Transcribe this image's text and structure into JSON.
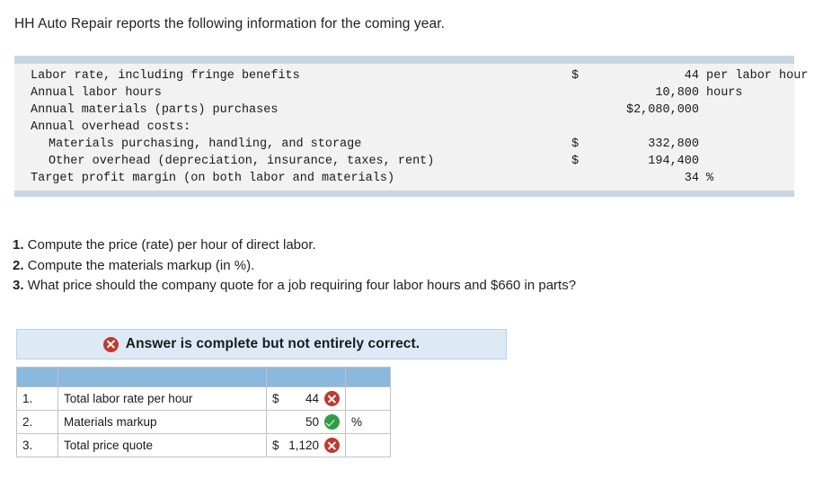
{
  "intro": "HH Auto Repair reports the following information for the coming year.",
  "facts": [
    {
      "label": "Labor rate, including fringe benefits",
      "currency": "$",
      "value": "44",
      "unit": "per labor hour",
      "indent": 0
    },
    {
      "label": "Annual labor hours",
      "currency": "",
      "value": "10,800",
      "unit": "hours",
      "indent": 0
    },
    {
      "label": "Annual materials (parts) purchases",
      "currency": "",
      "value": "$2,080,000",
      "unit": "",
      "indent": 0
    },
    {
      "label": "Annual overhead costs:",
      "currency": "",
      "value": "",
      "unit": "",
      "indent": 0
    },
    {
      "label": "Materials purchasing, handling, and storage",
      "currency": "$",
      "value": "332,800",
      "unit": "",
      "indent": 1
    },
    {
      "label": "Other overhead (depreciation, insurance, taxes, rent)",
      "currency": "$",
      "value": "194,400",
      "unit": "",
      "indent": 1
    },
    {
      "label": "Target profit margin (on both labor and materials)",
      "currency": "",
      "value": "34",
      "unit": "%",
      "indent": 0
    }
  ],
  "questions": [
    {
      "num": "1.",
      "text": " Compute the price (rate) per hour of direct labor."
    },
    {
      "num": "2.",
      "text": " Compute the materials markup (in %)."
    },
    {
      "num": "3.",
      "text": " What price should the company quote for a job requiring four labor hours and $660 in parts?"
    }
  ],
  "banner": {
    "icon": "error-circle-x-icon",
    "text": "Answer is complete but not entirely correct."
  },
  "answer_table": {
    "columns": [
      "",
      "",
      "",
      ""
    ],
    "rows": [
      {
        "num": "1.",
        "label": "Total labor rate per hour",
        "currency": "$",
        "value": "44",
        "status": "incorrect",
        "unit": ""
      },
      {
        "num": "2.",
        "label": "Materials markup",
        "currency": "",
        "value": "50",
        "status": "correct",
        "unit": "%"
      },
      {
        "num": "3.",
        "label": "Total price quote",
        "currency": "$",
        "value": "1,120",
        "status": "incorrect",
        "unit": ""
      }
    ]
  },
  "colors": {
    "header_bar": "#c9d6e4",
    "fact_bg": "#f2f2f2",
    "banner_bg": "#ddeaf6",
    "banner_border": "#b8d2ea",
    "table_header": "#8bb8dd",
    "incorrect": "#bf3a30",
    "correct": "#2f9e44"
  }
}
